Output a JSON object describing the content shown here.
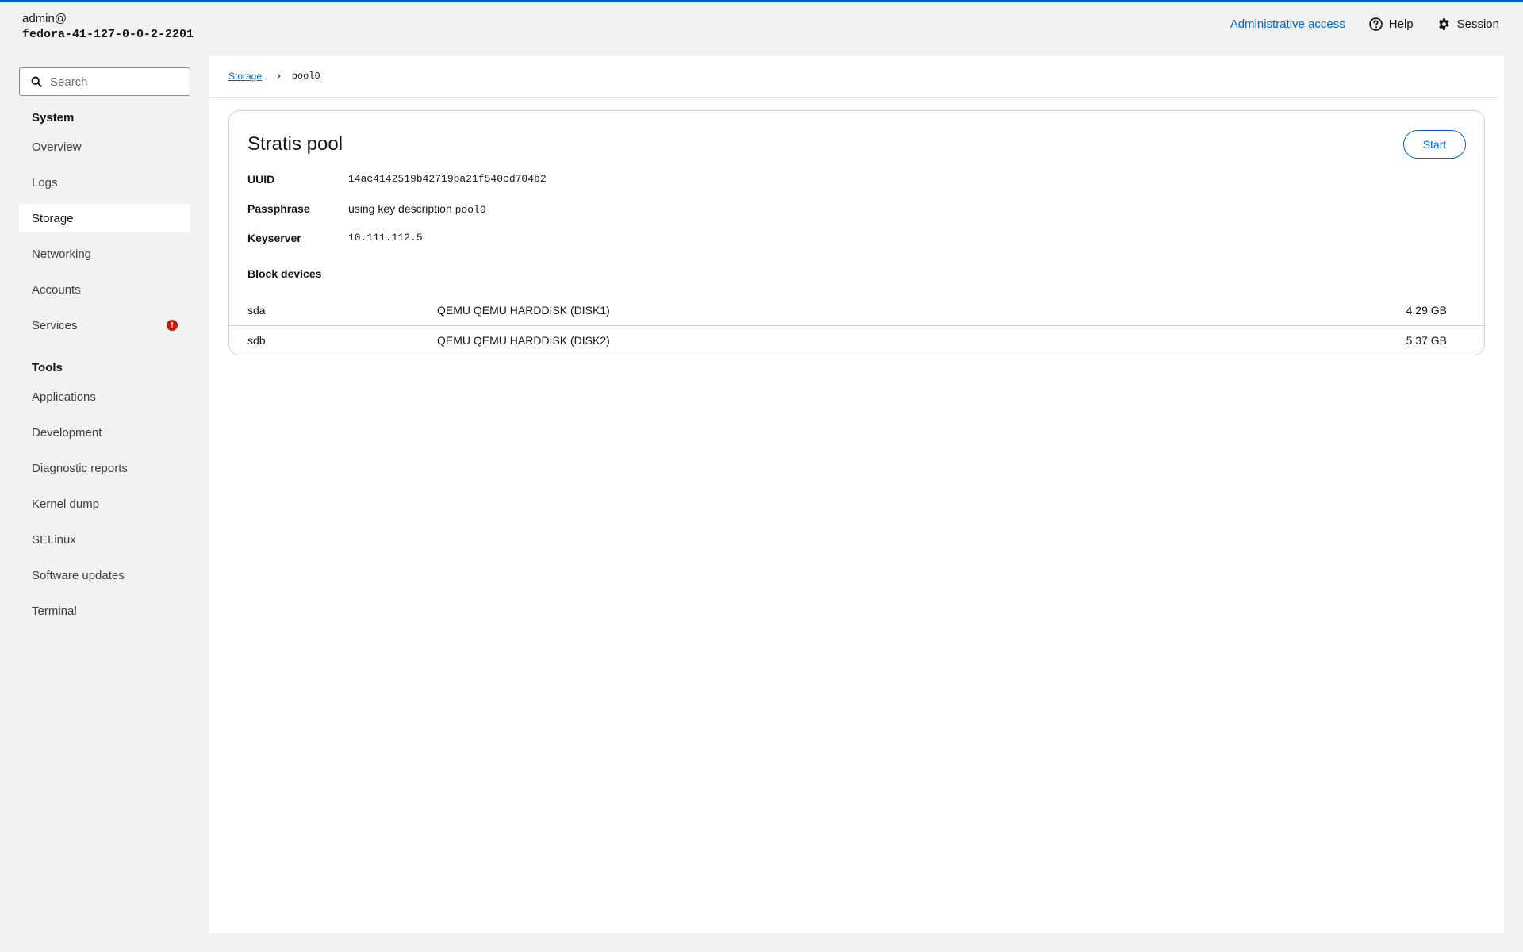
{
  "header": {
    "user": "admin@",
    "hostname": "fedora-41-127-0-0-2-2201",
    "admin_access": "Administrative access",
    "help": "Help",
    "session": "Session"
  },
  "sidebar": {
    "search_placeholder": "Search",
    "system_title": "System",
    "system_items": [
      {
        "label": "Overview"
      },
      {
        "label": "Logs"
      },
      {
        "label": "Storage",
        "active": true
      },
      {
        "label": "Networking"
      },
      {
        "label": "Accounts"
      },
      {
        "label": "Services",
        "badge": "!"
      }
    ],
    "tools_title": "Tools",
    "tools_items": [
      {
        "label": "Applications"
      },
      {
        "label": "Development"
      },
      {
        "label": "Diagnostic reports"
      },
      {
        "label": "Kernel dump"
      },
      {
        "label": "SELinux"
      },
      {
        "label": "Software updates"
      },
      {
        "label": "Terminal"
      }
    ]
  },
  "breadcrumb": {
    "parent": "Storage",
    "current": "pool0"
  },
  "pool": {
    "title": "Stratis pool",
    "start_label": "Start",
    "uuid_label": "UUID",
    "uuid": "14ac4142519b42719ba21f540cd704b2",
    "passphrase_label": "Passphrase",
    "passphrase_prefix": "using key description ",
    "passphrase_key": "pool0",
    "keyserver_label": "Keyserver",
    "keyserver": "10.111.112.5",
    "block_devices_title": "Block devices",
    "devices": [
      {
        "name": "sda",
        "model": "QEMU QEMU HARDDISK (DISK1)",
        "size": "4.29 GB"
      },
      {
        "name": "sdb",
        "model": "QEMU QEMU HARDDISK (DISK2)",
        "size": "5.37 GB"
      }
    ]
  },
  "colors": {
    "accent": "#0066cc",
    "danger": "#c9190b"
  }
}
